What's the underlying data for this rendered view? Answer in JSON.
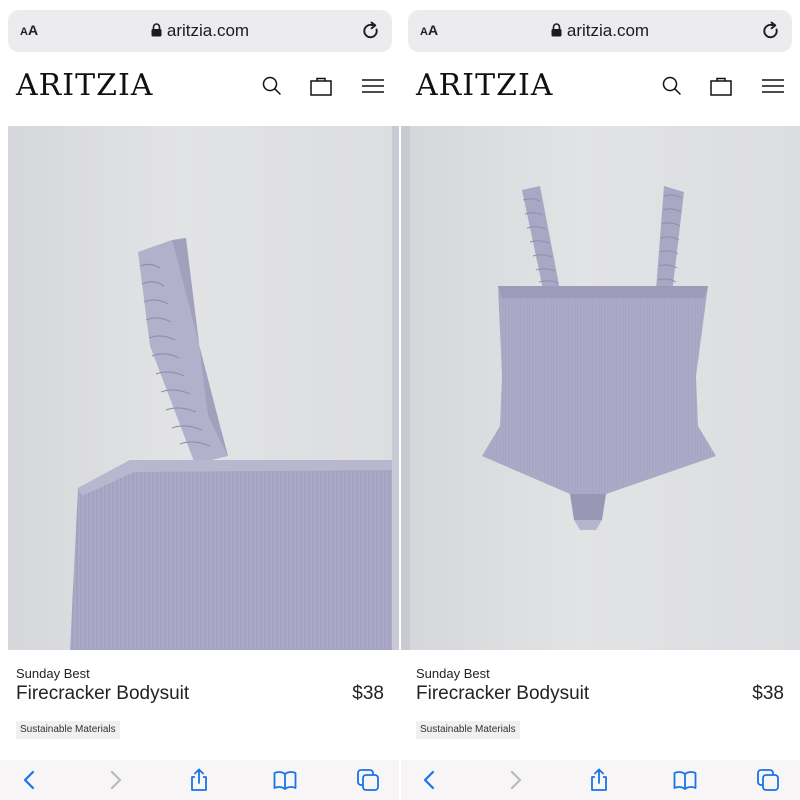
{
  "browser": {
    "aa_label_big": "A",
    "aa_label_small": "A",
    "domain": "aritzia.com"
  },
  "site": {
    "logo": "ARITZIA"
  },
  "panels": [
    {
      "view": "close-up",
      "product": {
        "brand": "Sunday Best",
        "name": "Firecracker Bodysuit",
        "price": "$38",
        "badge": "Sustainable Materials"
      }
    },
    {
      "view": "full",
      "product": {
        "brand": "Sunday Best",
        "name": "Firecracker Bodysuit",
        "price": "$38",
        "badge": "Sustainable Materials"
      }
    }
  ],
  "icons": {
    "header": [
      "search-icon",
      "bag-icon",
      "menu-icon"
    ],
    "toolbar": [
      "back-icon",
      "forward-icon",
      "share-icon",
      "bookmarks-icon",
      "tabs-icon"
    ]
  },
  "colors": {
    "accent": "#1a73e8",
    "garment": "#aeaec8",
    "photo_bg": "#dedfe1"
  }
}
